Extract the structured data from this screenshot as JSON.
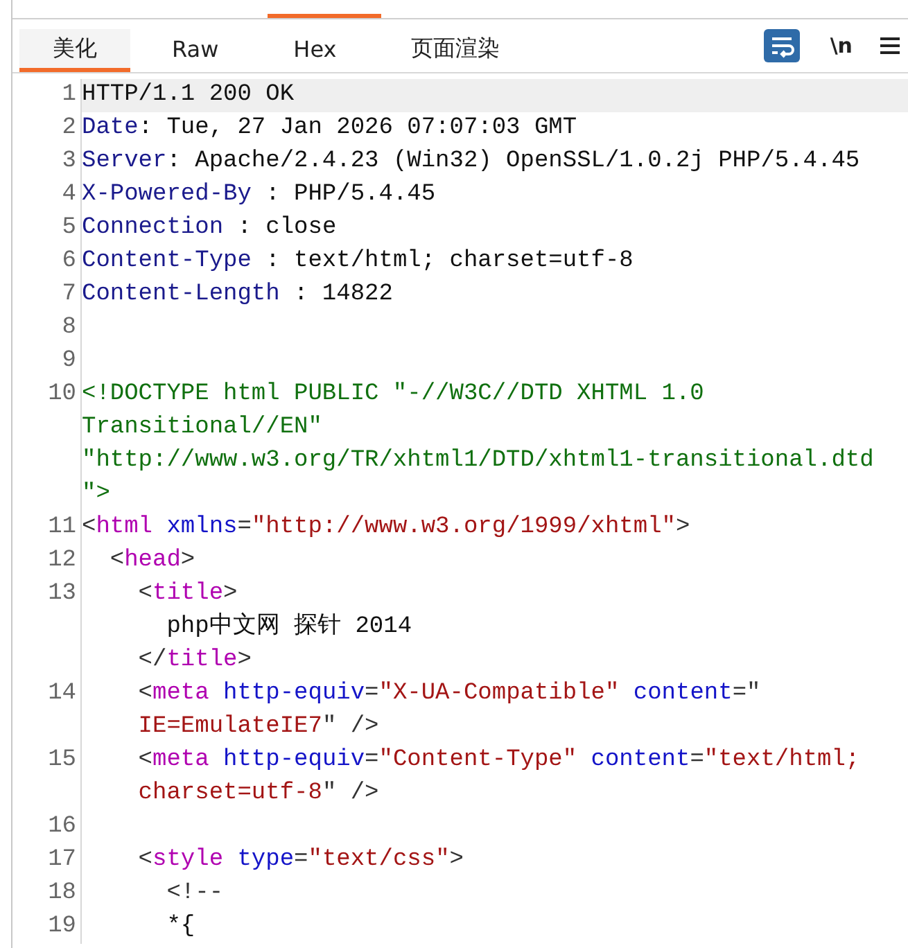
{
  "top_tabs": [
    {
      "selected": false
    },
    {
      "selected": false
    },
    {
      "selected": true
    }
  ],
  "view_tabs": [
    {
      "label": "美化",
      "selected": true
    },
    {
      "label": "Raw",
      "selected": false
    },
    {
      "label": "Hex",
      "selected": false
    },
    {
      "label": "页面渲染",
      "selected": false
    }
  ],
  "toolbar": {
    "wrap_on": true,
    "newline_label": "\\n"
  },
  "lines": [
    {
      "number": "1",
      "current": true,
      "rows": [
        {
          "tokens": [
            {
              "kind": "plain",
              "text": "HTTP/1.1 200 OK"
            }
          ]
        }
      ]
    },
    {
      "number": "2",
      "current": false,
      "rows": [
        {
          "tokens": [
            {
              "kind": "key",
              "text": "Date"
            },
            {
              "kind": "plain",
              "text": ": Tue, 27 Jan 2026 07:07:03 GMT"
            }
          ]
        }
      ]
    },
    {
      "number": "3",
      "current": false,
      "rows": [
        {
          "tokens": [
            {
              "kind": "key",
              "text": "Server"
            },
            {
              "kind": "plain",
              "text": ": Apache/2.4.23 (Win32) OpenSSL/1.0.2j PHP/5.4.45"
            }
          ]
        }
      ]
    },
    {
      "number": "4",
      "current": false,
      "rows": [
        {
          "tokens": [
            {
              "kind": "key",
              "text": "X-Powered-By"
            },
            {
              "kind": "plain",
              "text": " : PHP/5.4.45"
            }
          ]
        }
      ]
    },
    {
      "number": "5",
      "current": false,
      "rows": [
        {
          "tokens": [
            {
              "kind": "key",
              "text": "Connection"
            },
            {
              "kind": "plain",
              "text": " : close"
            }
          ]
        }
      ]
    },
    {
      "number": "6",
      "current": false,
      "rows": [
        {
          "tokens": [
            {
              "kind": "key",
              "text": "Content-Type"
            },
            {
              "kind": "plain",
              "text": " : text/html; charset=utf-8"
            }
          ]
        }
      ]
    },
    {
      "number": "7",
      "current": false,
      "rows": [
        {
          "tokens": [
            {
              "kind": "key",
              "text": "Content-Length"
            },
            {
              "kind": "plain",
              "text": " : 14822"
            }
          ]
        }
      ]
    },
    {
      "number": "8",
      "current": false
    },
    {
      "number": "9",
      "current": false
    },
    {
      "number": "10",
      "current": false,
      "rows": [
        {
          "tokens": [
            {
              "kind": "doctype",
              "text": "<!DOCTYPE html PUBLIC \"-//W3C//DTD XHTML 1.0"
            }
          ]
        },
        {
          "tokens": [
            {
              "kind": "doctype",
              "text": "Transitional//EN\""
            }
          ]
        },
        {
          "tokens": [
            {
              "kind": "doctype",
              "text": "\"http://www.w3.org/TR/xhtml1/DTD/xhtml1-transitional.dtd"
            }
          ]
        },
        {
          "tokens": [
            {
              "kind": "doctype",
              "text": "\">"
            }
          ]
        }
      ]
    },
    {
      "number": "11",
      "current": false,
      "rows": [
        {
          "tokens": [
            {
              "kind": "punct",
              "text": "<"
            },
            {
              "kind": "tag",
              "text": "html"
            },
            {
              "kind": "attr",
              "text": " xmlns"
            },
            {
              "kind": "punct",
              "text": "="
            },
            {
              "kind": "string",
              "text": "\"http://www.w3.org/1999/xhtml\""
            },
            {
              "kind": "punct",
              "text": ">"
            }
          ]
        }
      ]
    },
    {
      "number": "12",
      "current": false,
      "rows": [
        {
          "tokens": [
            {
              "kind": "punct",
              "text": "  <"
            },
            {
              "kind": "tag",
              "text": "head"
            },
            {
              "kind": "punct",
              "text": ">"
            }
          ]
        }
      ]
    },
    {
      "number": "13",
      "current": false,
      "rows": [
        {
          "tokens": [
            {
              "kind": "punct",
              "text": "    <"
            },
            {
              "kind": "tag",
              "text": "title"
            },
            {
              "kind": "punct",
              "text": ">"
            }
          ]
        },
        {
          "tokens": [
            {
              "kind": "plain",
              "text": "      php中文网 探针 2014"
            }
          ]
        },
        {
          "tokens": [
            {
              "kind": "punct",
              "text": "    </"
            },
            {
              "kind": "tag",
              "text": "title"
            },
            {
              "kind": "punct",
              "text": ">"
            }
          ]
        }
      ]
    },
    {
      "number": "14",
      "current": false,
      "rows": [
        {
          "tokens": [
            {
              "kind": "punct",
              "text": "    <"
            },
            {
              "kind": "tag",
              "text": "meta"
            },
            {
              "kind": "attr",
              "text": " http-equiv"
            },
            {
              "kind": "punct",
              "text": "="
            },
            {
              "kind": "string",
              "text": "\"X-UA-Compatible\""
            },
            {
              "kind": "attr",
              "text": " content"
            },
            {
              "kind": "punct",
              "text": "=\""
            }
          ]
        },
        {
          "tokens": [
            {
              "kind": "string",
              "text": "    IE=EmulateIE7"
            },
            {
              "kind": "punct",
              "text": "\" />"
            }
          ]
        }
      ]
    },
    {
      "number": "15",
      "current": false,
      "rows": [
        {
          "tokens": [
            {
              "kind": "punct",
              "text": "    <"
            },
            {
              "kind": "tag",
              "text": "meta"
            },
            {
              "kind": "attr",
              "text": " http-equiv"
            },
            {
              "kind": "punct",
              "text": "="
            },
            {
              "kind": "string",
              "text": "\"Content-Type\""
            },
            {
              "kind": "attr",
              "text": " content"
            },
            {
              "kind": "punct",
              "text": "="
            },
            {
              "kind": "string",
              "text": "\"text/html;"
            }
          ]
        },
        {
          "tokens": [
            {
              "kind": "string",
              "text": "    charset=utf-8"
            },
            {
              "kind": "punct",
              "text": "\" />"
            }
          ]
        }
      ]
    },
    {
      "number": "16",
      "current": false
    },
    {
      "number": "17",
      "current": false,
      "rows": [
        {
          "tokens": [
            {
              "kind": "punct",
              "text": "    <"
            },
            {
              "kind": "tag",
              "text": "style"
            },
            {
              "kind": "attr",
              "text": " type"
            },
            {
              "kind": "punct",
              "text": "="
            },
            {
              "kind": "string",
              "text": "\"text/css\""
            },
            {
              "kind": "punct",
              "text": ">"
            }
          ]
        }
      ]
    },
    {
      "number": "18",
      "current": false,
      "rows": [
        {
          "tokens": [
            {
              "kind": "punct",
              "text": "      <!--"
            }
          ]
        }
      ]
    },
    {
      "number": "19",
      "current": false,
      "rows": [
        {
          "tokens": [
            {
              "kind": "plain",
              "text": "      *{"
            }
          ]
        }
      ]
    }
  ]
}
